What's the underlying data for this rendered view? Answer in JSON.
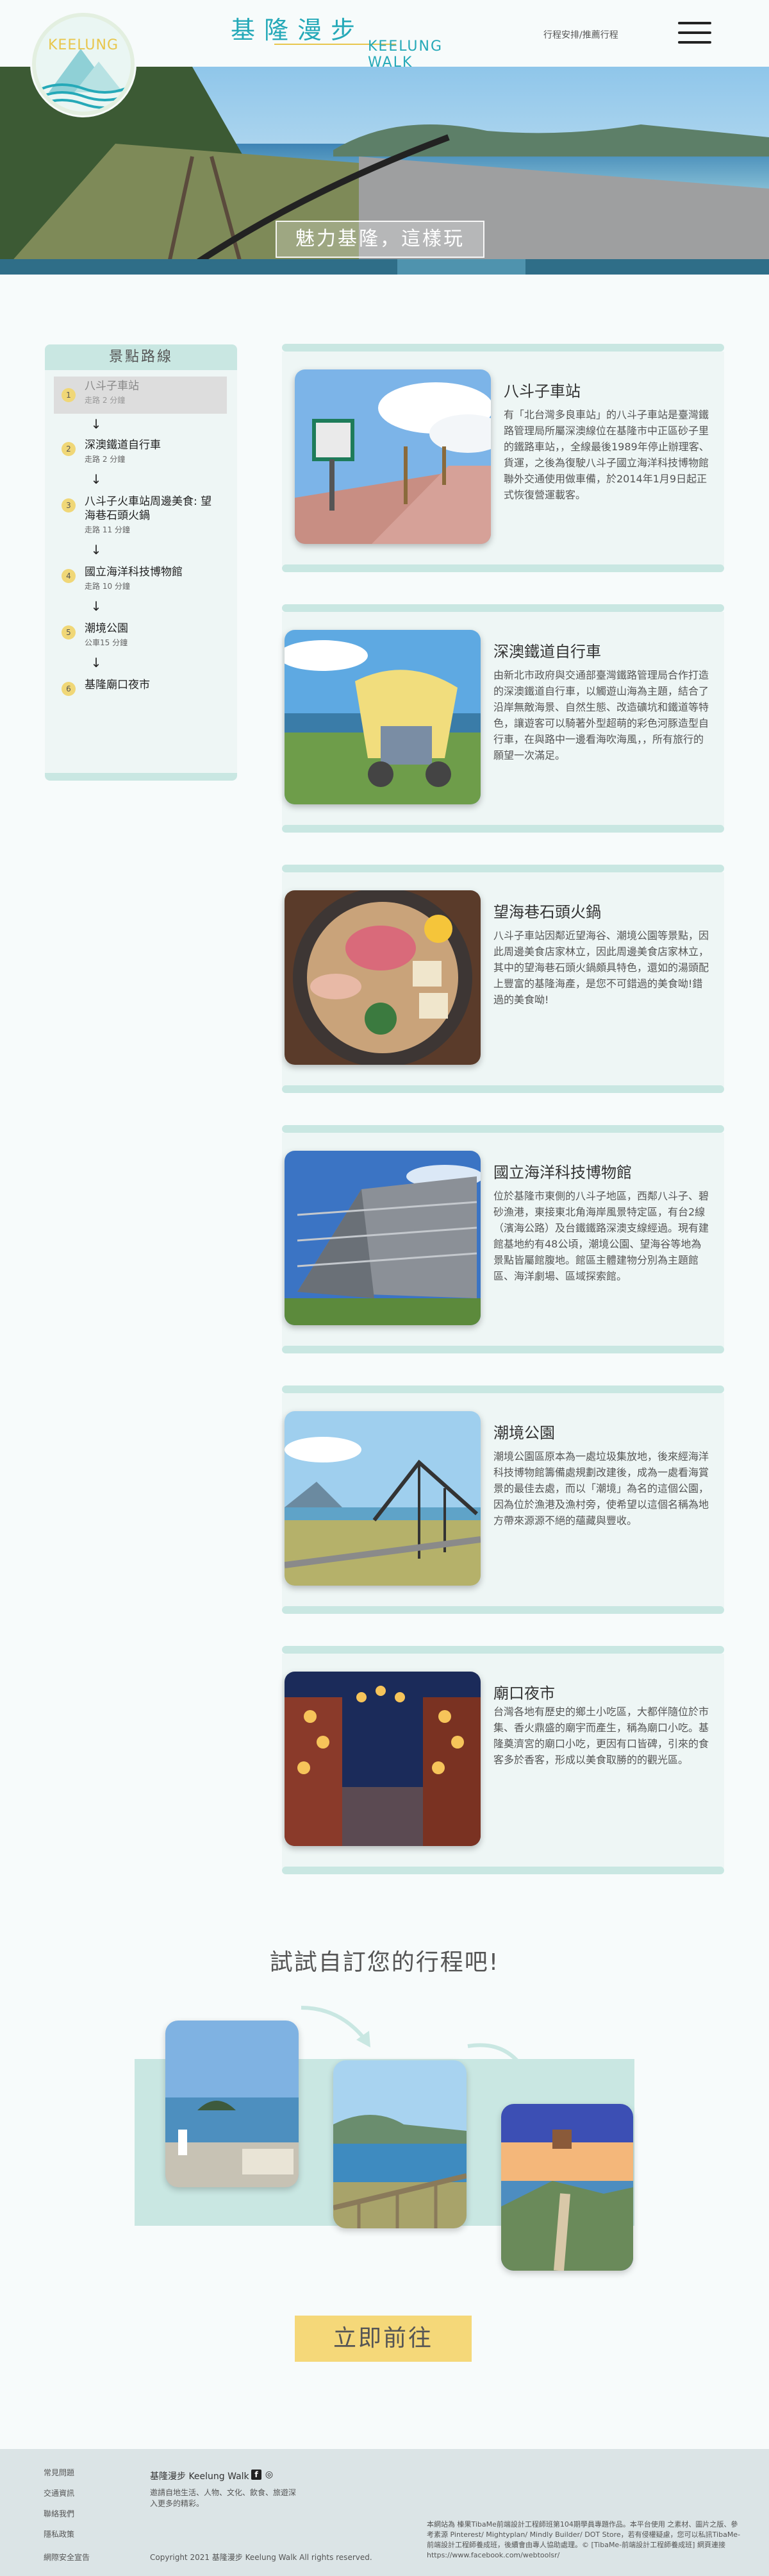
{
  "header": {
    "logo_text": "KEELUNG",
    "brand_zh": "基隆漫步",
    "brand_en": "KEELUNG WALK",
    "nav_link": "行程安排/推薦行程"
  },
  "hero": {
    "caption": "魅力基隆，這樣玩"
  },
  "sidebar": {
    "title": "景點路線",
    "stops": [
      {
        "num": "1",
        "name": "八斗子車站",
        "time": "走路 2 分鐘"
      },
      {
        "num": "2",
        "name": "深澳鐵道自行車",
        "time": "走路 2 分鐘"
      },
      {
        "num": "3",
        "name": "八斗子火車站周邊美食: 望海巷石頭火鍋",
        "time": "走路 11 分鐘"
      },
      {
        "num": "4",
        "name": "國立海洋科技博物館",
        "time": "走路 10 分鐘"
      },
      {
        "num": "5",
        "name": "潮境公園",
        "time": "公車15 分鐘"
      },
      {
        "num": "6",
        "name": "基隆廟口夜市",
        "time": ""
      }
    ]
  },
  "spots": [
    {
      "title": "八斗子車站",
      "desc": "有「北台灣多良車站」的八斗子車站是臺灣鐵路管理局所屬深澳線位在基隆市中正區砂子里的鐵路車站，，全線最後1989年停止辦理客、貨運，之後為復駛八斗子國立海洋科技博物館聯外交通使用做車備，於2014年1月9日起正式恢復營運載客。"
    },
    {
      "title": "深澳鐵道自行車",
      "desc": "由新北市政府與交通部臺灣鐵路管理局合作打造的深澳鐵道自行車，以觸遊山海為主題，結合了沿岸無敵海景、自然生態、改造礦坑和鐵道等特色，讓遊客可以騎著外型超萌的彩色河豚造型自行車，在與路中一邊看海吹海風，，所有旅行的願望一次滿足。"
    },
    {
      "title": "望海巷石頭火鍋",
      "desc": "八斗子車站因鄰近望海谷、潮境公園等景點，因此周邊美食店家林立，因此周邊美食店家林立，其中的望海巷石頭火鍋頗具特色，還如的湯頭配上豐富的基隆海產，是您不可錯過的美食呦!錯過的美食呦!"
    },
    {
      "title": "國立海洋科技博物館",
      "desc": "位於基隆市東側的八斗子地區，西鄰八斗子、碧砂漁港，東接東北角海岸風景特定區，有台2線（濱海公路）及台鐵鐵路深澳支線經過。現有建館基地約有48公頃，潮境公園、望海谷等地為景點皆屬館腹地。館區主體建物分別為主題館區、海洋劇場、區域探索館。"
    },
    {
      "title": "潮境公園",
      "desc": "潮境公園區原本為一處垃圾集放地，後來經海洋科技博物館籌備處規劃改建後，成為一處看海賞景的最佳去處，而以「潮境」為名的這個公園，因為位於漁港及漁村旁，使希望以這個名稱為地方帶來源源不絕的蘊藏與豐收。"
    },
    {
      "title": "廟口夜市",
      "desc": "台灣各地有歷史的鄉土小吃區，大都伴隨位於市集、香火鼎盛的廟宇而產生，稱為廟口小吃。基隆奠濟宮的廟口小吃，更因有口皆碑，引來的食客多於香客，形成以美食取勝的的觀光區。"
    }
  ],
  "custom": {
    "title": "試試自訂您的行程吧!",
    "button": "立即前往"
  },
  "footer": {
    "links": [
      "常見問題",
      "交通資訊",
      "聯絡我們",
      "隱私政策",
      "網際安全宣告"
    ],
    "brand": "基隆漫步 Keelung Walk",
    "fb_icon": "f",
    "ig_icon": "◎",
    "desc": "邀請自地生活、人物、文化、飲食、旅遊深入更多的精彩。",
    "copyright": "Copyright 2021 基隆漫步 Keelung Walk All rights reserved.",
    "note": "本網站為 榛果TibaMe前端設計工程師班第104期學員專題作品。本平台使用 之素材、圖片之版、參考素源 Pinterest/ Mightyplan/ Mindly Builder/ DOT Store，若有侵權疑慮，您可以私訊TibaMe-前端設計工程師養成班，後續會由專人協助處理。© [TibaMe-前端設計工程師養成班] 網頁連接https://www.facebook.com/webtoolsr/"
  }
}
